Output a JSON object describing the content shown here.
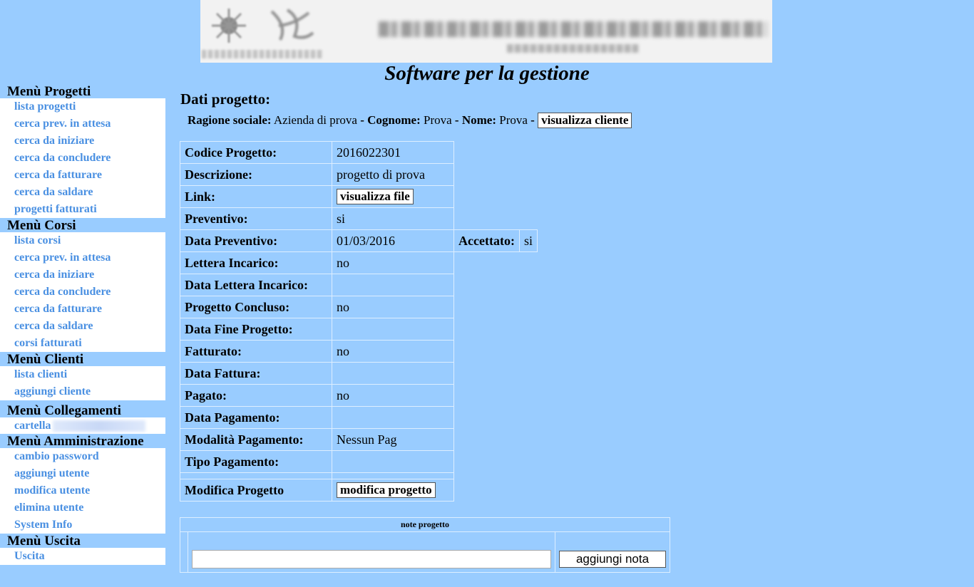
{
  "app_title": "Software per la gestione",
  "sidebar": {
    "menus": [
      {
        "title": "Menù Progetti",
        "items": [
          "lista progetti",
          "cerca prev. in attesa",
          "cerca da iniziare",
          "cerca da concludere",
          "cerca da fatturare",
          "cerca da saldare",
          "progetti fatturati"
        ]
      },
      {
        "title": "Menù Corsi",
        "items": [
          "lista corsi",
          "cerca prev. in attesa",
          "cerca da iniziare",
          "cerca da concludere",
          "cerca da fatturare",
          "cerca da saldare",
          "corsi fatturati"
        ]
      },
      {
        "title": "Menù Clienti",
        "items": [
          "lista clienti",
          "aggiungi cliente"
        ]
      },
      {
        "title": "Menù Collegamenti",
        "items": [
          "cartella"
        ]
      },
      {
        "title": "Menù Amministrazione",
        "items": [
          "cambio password",
          "aggiungi utente",
          "modifica utente",
          "elimina utente",
          "System Info"
        ]
      },
      {
        "title": "Menù Uscita",
        "items": [
          "Uscita"
        ]
      }
    ]
  },
  "main": {
    "title": "Dati progetto:",
    "client": {
      "ragione_label": "Ragione sociale:",
      "ragione_value": "Azienda di prova",
      "sep": "-",
      "cognome_label": "Cognome:",
      "cognome_value": "Prova",
      "nome_label": "Nome:",
      "nome_value": "Prova",
      "button": "visualizza cliente"
    },
    "rows": [
      {
        "label": "Codice Progetto:",
        "value": "2016022301"
      },
      {
        "label": "Descrizione:",
        "value": "progetto di prova"
      },
      {
        "label": "Link:",
        "button": "visualizza file"
      },
      {
        "label": "Preventivo:",
        "value": "si"
      },
      {
        "label": "Data Preventivo:",
        "value": "01/03/2016",
        "extra_label": "Accettato:",
        "extra_value": "si"
      },
      {
        "label": "Lettera Incarico:",
        "value": "no"
      },
      {
        "label": "Data Lettera Incarico:",
        "value": ""
      },
      {
        "label": "Progetto Concluso:",
        "value": "no"
      },
      {
        "label": "Data Fine Progetto:",
        "value": ""
      },
      {
        "label": "Fatturato:",
        "value": "no"
      },
      {
        "label": "Data Fattura:",
        "value": ""
      },
      {
        "label": "Pagato:",
        "value": "no"
      },
      {
        "label": "Data Pagamento:",
        "value": ""
      },
      {
        "label": "Modalità Pagamento:",
        "value": "Nessun Pag"
      },
      {
        "label": "Tipo Pagamento:",
        "value": ""
      }
    ],
    "modify": {
      "label": "Modifica Progetto",
      "button": "modifica progetto"
    },
    "notes": {
      "header": "note progetto",
      "input_value": "",
      "button": "aggiungi nota"
    }
  }
}
